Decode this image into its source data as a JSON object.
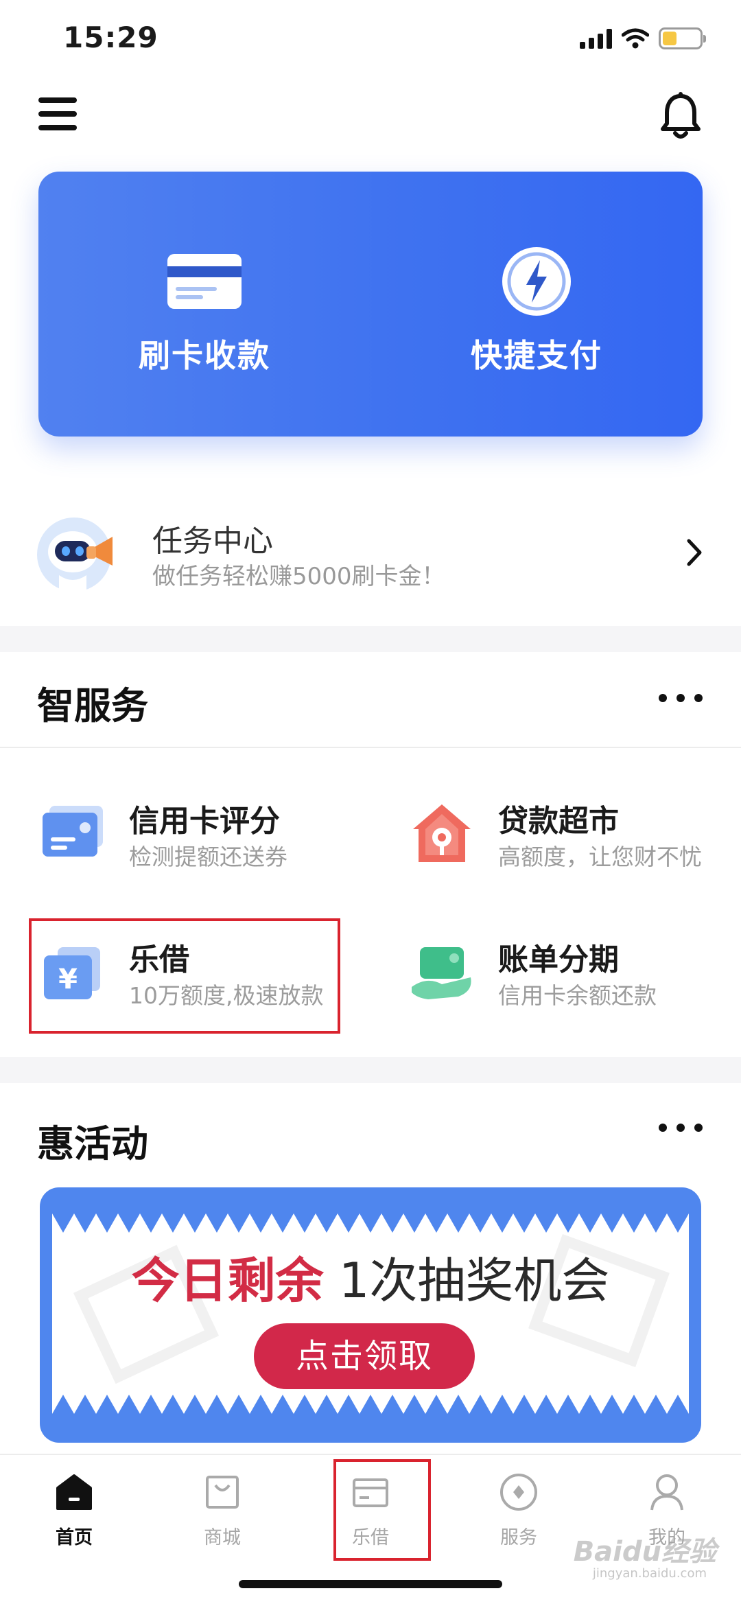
{
  "status_bar": {
    "time": "15:29"
  },
  "colors": {
    "accent": "#3F72F0",
    "highlight": "#D9232E",
    "promo_red": "#D2284A"
  },
  "hero": {
    "items": [
      {
        "label": "刷卡收款",
        "icon": "card-icon"
      },
      {
        "label": "快捷支付",
        "icon": "lightning-icon"
      }
    ]
  },
  "task_center": {
    "title": "任务中心",
    "subtitle": "做任务轻松赚5000刷卡金！"
  },
  "smart_services": {
    "title": "智服务",
    "items": [
      {
        "title": "信用卡评分",
        "subtitle": "检测提额还送券",
        "icon": "credit-card-score-icon"
      },
      {
        "title": "贷款超市",
        "subtitle": "高额度，让您财不忧",
        "icon": "loan-market-icon"
      },
      {
        "title": "乐借",
        "subtitle": "10万额度,极速放款",
        "icon": "yuan-cards-icon"
      },
      {
        "title": "账单分期",
        "subtitle": "信用卡余额还款",
        "icon": "bill-installment-icon"
      }
    ]
  },
  "activities": {
    "title": "惠活动",
    "promo": {
      "highlight": "今日剩余",
      "text": "1次抽奖机会",
      "button": "点击领取"
    }
  },
  "tab_bar": {
    "items": [
      {
        "label": "首页",
        "icon": "home-icon",
        "active": true
      },
      {
        "label": "商城",
        "icon": "shopping-bag-icon",
        "active": false
      },
      {
        "label": "乐借",
        "icon": "wallet-icon",
        "active": false
      },
      {
        "label": "服务",
        "icon": "service-icon",
        "active": false
      },
      {
        "label": "我的",
        "icon": "profile-icon",
        "active": false
      }
    ]
  },
  "watermark": {
    "text": "Baidu经验",
    "sub": "jingyan.baidu.com"
  }
}
